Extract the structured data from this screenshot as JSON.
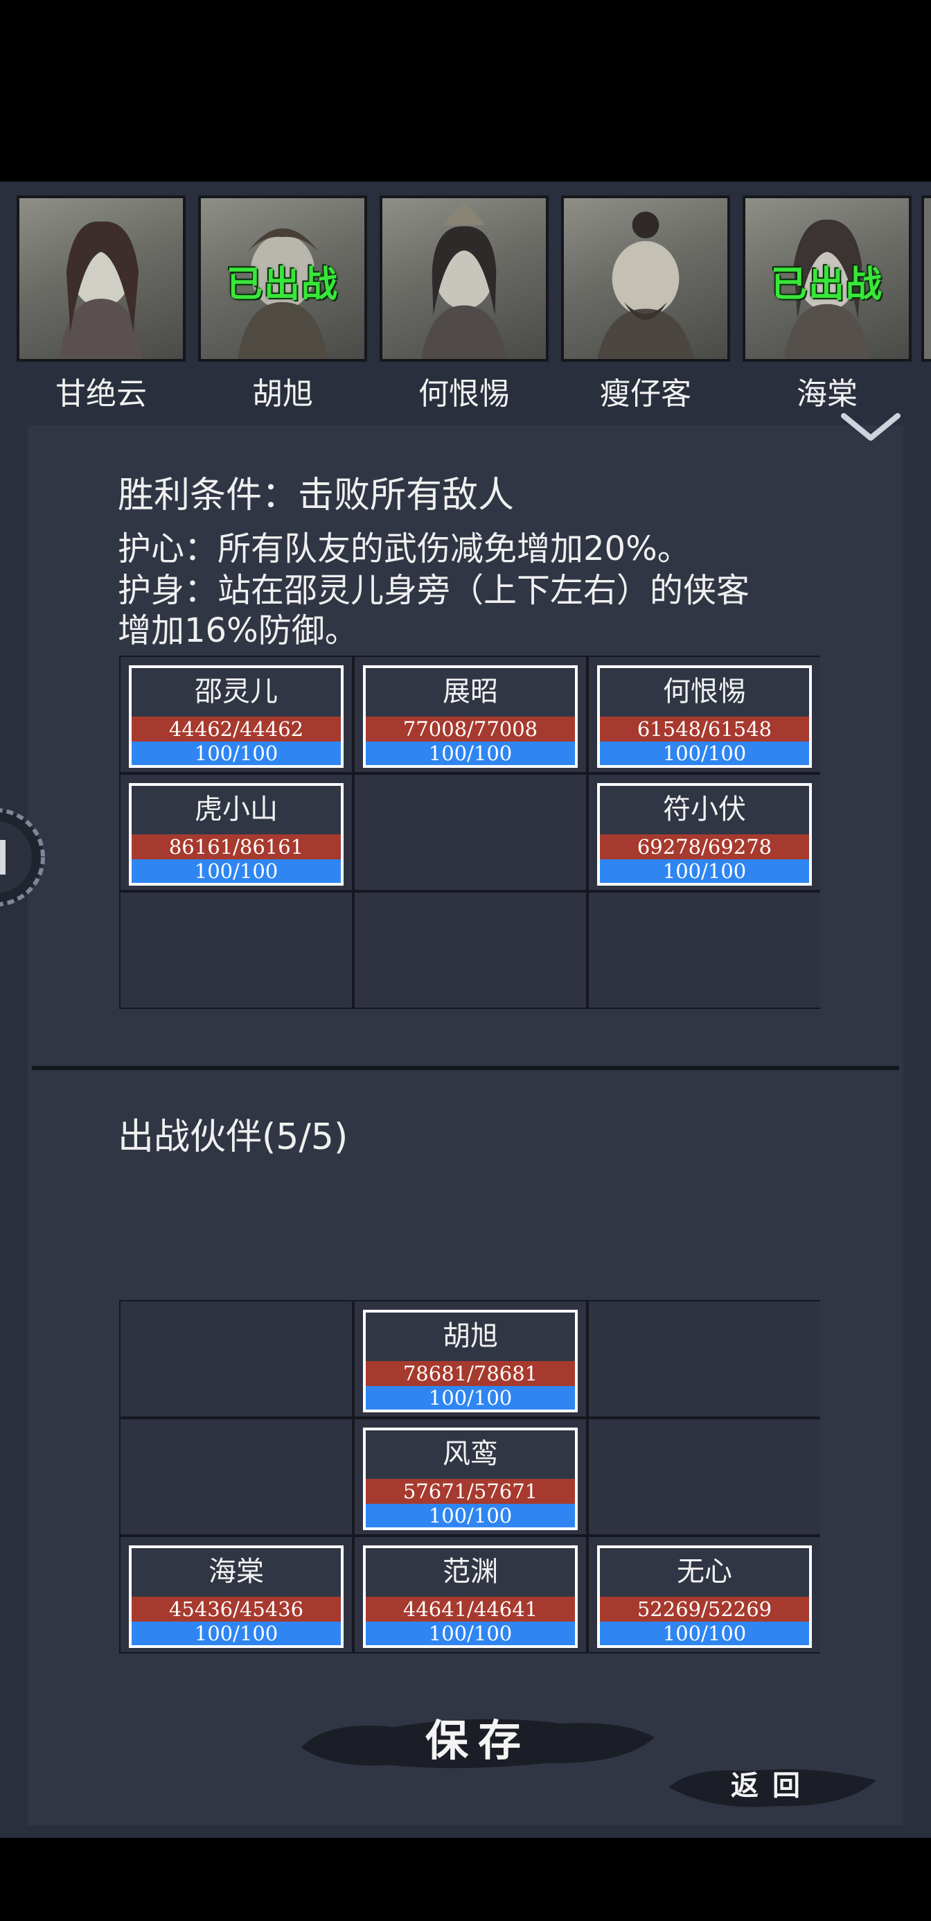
{
  "roster": [
    {
      "name": "甘绝云",
      "deployed": false
    },
    {
      "name": "胡旭",
      "deployed": true
    },
    {
      "name": "何恨惕",
      "deployed": false
    },
    {
      "name": "瘦仔客",
      "deployed": false
    },
    {
      "name": "海棠",
      "deployed": true
    }
  ],
  "deployed_label": "已出战",
  "battle": {
    "victory": "胜利条件：击败所有敌人",
    "desc_lines": [
      "护心：所有队友的武伤减免增加20%。",
      "护身：站在邵灵儿身旁（上下左右）的侠客",
      "增加16%防御。"
    ]
  },
  "enemy_grid": [
    {
      "row": 0,
      "col": 0,
      "name": "邵灵儿",
      "hp": "44462/44462",
      "mp": "100/100"
    },
    {
      "row": 0,
      "col": 1,
      "name": "展昭",
      "hp": "77008/77008",
      "mp": "100/100"
    },
    {
      "row": 0,
      "col": 2,
      "name": "何恨惕",
      "hp": "61548/61548",
      "mp": "100/100"
    },
    {
      "row": 1,
      "col": 0,
      "name": "虎小山",
      "hp": "86161/86161",
      "mp": "100/100"
    },
    {
      "row": 1,
      "col": 2,
      "name": "符小伏",
      "hp": "69278/69278",
      "mp": "100/100"
    }
  ],
  "party": {
    "title": "出战伙伴(5/5)",
    "grid": [
      {
        "row": 0,
        "col": 1,
        "name": "胡旭",
        "hp": "78681/78681",
        "mp": "100/100"
      },
      {
        "row": 1,
        "col": 1,
        "name": "风鸾",
        "hp": "57671/57671",
        "mp": "100/100"
      },
      {
        "row": 2,
        "col": 0,
        "name": "海棠",
        "hp": "45436/45436",
        "mp": "100/100"
      },
      {
        "row": 2,
        "col": 1,
        "name": "范渊",
        "hp": "44641/44641",
        "mp": "100/100"
      },
      {
        "row": 2,
        "col": 2,
        "name": "无心",
        "hp": "52269/52269",
        "mp": "100/100"
      }
    ]
  },
  "buttons": {
    "save": "保存",
    "back": "返回"
  },
  "icons": {
    "collapse": "chevron-down-icon"
  },
  "colors": {
    "background": "#2a2f3d",
    "panel": "#313645",
    "deployed_text": "#39e63a",
    "hp_bar": "#a73a2e",
    "mp_bar": "#2f86f2",
    "card_border": "#ffffff"
  }
}
